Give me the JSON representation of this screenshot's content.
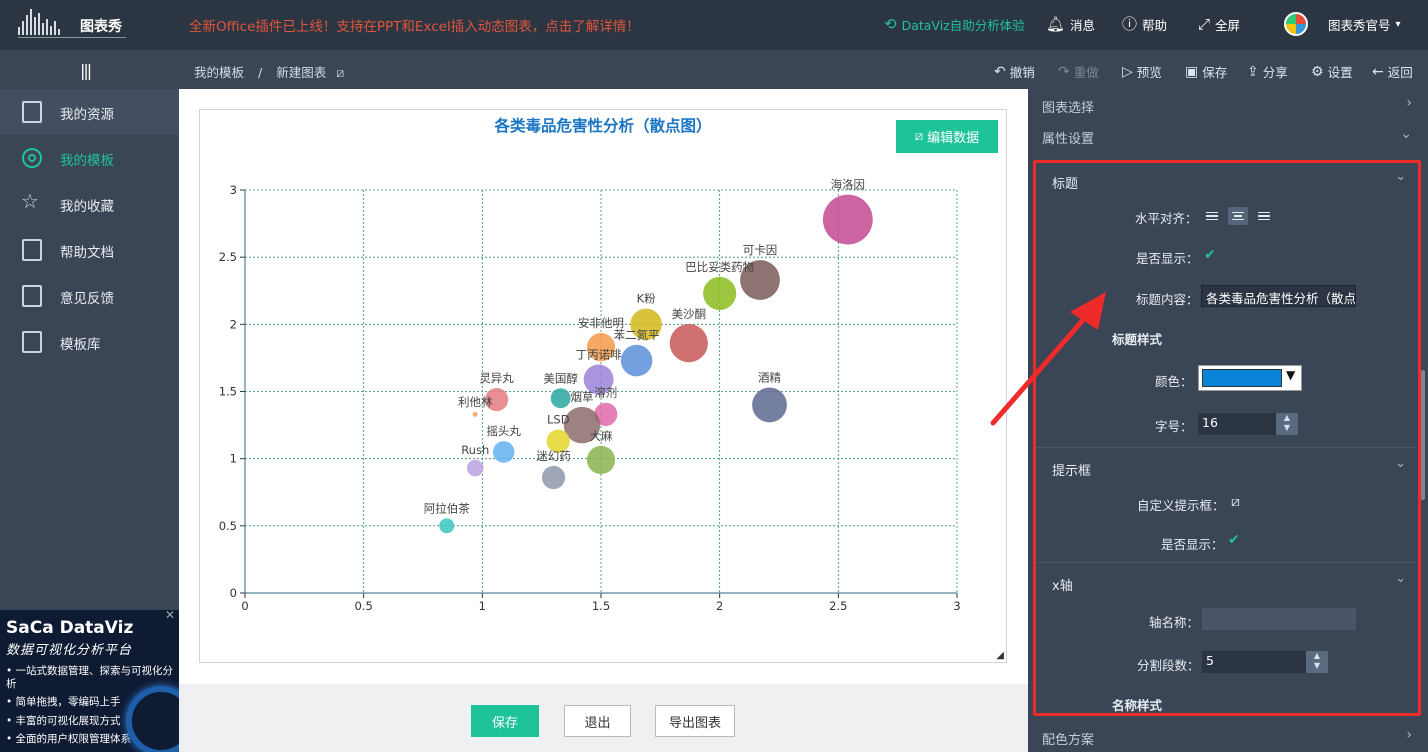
{
  "app": {
    "logo": "图表秀",
    "announcement": "全新Office插件已上线！支持在PPT和Excel插入动态图表，点击了解详情！",
    "dataviz_link": "DataViz自助分析体验",
    "message": "消息",
    "help": "帮助",
    "fullscreen": "全屏",
    "account": "图表秀官号"
  },
  "breadcrumb": {
    "root": "我的模板",
    "sep": "/",
    "current": "新建图表"
  },
  "toolbar": {
    "undo": "撤销",
    "redo": "重做",
    "preview": "预览",
    "save": "保存",
    "share": "分享",
    "settings": "设置",
    "back": "返回"
  },
  "sidebar": {
    "items": [
      {
        "label": "我的资源"
      },
      {
        "label": "我的模板"
      },
      {
        "label": "我的收藏"
      },
      {
        "label": "帮助文档"
      },
      {
        "label": "意见反馈"
      },
      {
        "label": "模板库"
      }
    ]
  },
  "promo": {
    "title": "SaCa DataViz",
    "subtitle": "数据可视化分析平台",
    "bullets": [
      "• 一站式数据管理、探索与可视化分析",
      "• 简单拖拽，零编码上手",
      "• 丰富的可视化展现方式",
      "• 全面的用户权限管理体系"
    ],
    "close": "✕"
  },
  "editor": {
    "edit_data": "编辑数据"
  },
  "bottom": {
    "save": "保存",
    "exit": "退出",
    "export": "导出图表"
  },
  "panel": {
    "chart_select": "图表选择",
    "property_settings": "属性设置",
    "color_scheme": "配色方案",
    "title_section": {
      "heading": "标题",
      "align_label": "水平对齐：",
      "show_label": "是否显示：",
      "content_label": "标题内容：",
      "content_value": "各类毒品危害性分析（散点",
      "style_heading": "标题样式",
      "color_label": "颜色：",
      "color_value": "#0a84d6",
      "size_label": "字号：",
      "size_value": "16"
    },
    "tooltip_section": {
      "heading": "提示框",
      "custom_label": "自定义提示框：",
      "show_label": "是否显示："
    },
    "xaxis_section": {
      "heading": "x轴",
      "name_label": "轴名称：",
      "name_value": "",
      "split_label": "分割段数：",
      "split_value": "5",
      "name_style": "名称样式"
    }
  },
  "chart_data": {
    "type": "scatter",
    "title": "各类毒品危害性分析（散点图）",
    "xlim": [
      0,
      3
    ],
    "ylim": [
      0,
      3
    ],
    "xticks": [
      "0",
      "0.5",
      "1",
      "1.5",
      "2",
      "2.5",
      "3"
    ],
    "yticks": [
      "0",
      "0.5",
      "1",
      "1.5",
      "2",
      "2.5",
      "3"
    ],
    "grid": true,
    "points": [
      {
        "name": "海洛因",
        "x": 2.54,
        "y": 2.78,
        "size": 3.0,
        "color": "#c2498f"
      },
      {
        "name": "可卡因",
        "x": 2.17,
        "y": 2.33,
        "size": 2.4,
        "color": "#7a5a5a"
      },
      {
        "name": "巴比妥类药物",
        "x": 2.0,
        "y": 2.23,
        "size": 2.0,
        "color": "#8bbb1e"
      },
      {
        "name": "K粉",
        "x": 1.69,
        "y": 2.0,
        "size": 1.9,
        "color": "#d4b81a"
      },
      {
        "name": "美沙酮",
        "x": 1.87,
        "y": 1.86,
        "size": 2.3,
        "color": "#c95757"
      },
      {
        "name": "苯二氮平",
        "x": 1.65,
        "y": 1.73,
        "size": 1.9,
        "color": "#5b8fd9"
      },
      {
        "name": "安非他明",
        "x": 1.5,
        "y": 1.83,
        "size": 1.7,
        "color": "#f39a4a"
      },
      {
        "name": "丁丙诺啡",
        "x": 1.49,
        "y": 1.59,
        "size": 1.8,
        "color": "#9b82d9"
      },
      {
        "name": "酒精",
        "x": 2.21,
        "y": 1.4,
        "size": 2.1,
        "color": "#5d6990"
      },
      {
        "name": "美国醇",
        "x": 1.33,
        "y": 1.45,
        "size": 1.2,
        "color": "#2aa6a0"
      },
      {
        "name": "溶剂",
        "x": 1.52,
        "y": 1.33,
        "size": 1.4,
        "color": "#e06aa9"
      },
      {
        "name": "烟草",
        "x": 1.42,
        "y": 1.25,
        "size": 2.2,
        "color": "#8d6b6b"
      },
      {
        "name": "灵异丸",
        "x": 1.06,
        "y": 1.44,
        "size": 1.4,
        "color": "#e37b7f"
      },
      {
        "name": "利他林",
        "x": 0.97,
        "y": 1.33,
        "size": 0.3,
        "color": "#f2a05a"
      },
      {
        "name": "LSD",
        "x": 1.32,
        "y": 1.13,
        "size": 1.4,
        "color": "#e3d52a"
      },
      {
        "name": "大麻",
        "x": 1.5,
        "y": 0.99,
        "size": 1.7,
        "color": "#8ab34f"
      },
      {
        "name": "摇头丸",
        "x": 1.09,
        "y": 1.05,
        "size": 1.3,
        "color": "#62b3f0"
      },
      {
        "name": "迷幻药",
        "x": 1.3,
        "y": 0.86,
        "size": 1.4,
        "color": "#8d96ab"
      },
      {
        "name": "Rush",
        "x": 0.97,
        "y": 0.93,
        "size": 1.0,
        "color": "#b9a2e0"
      },
      {
        "name": "阿拉伯茶",
        "x": 0.85,
        "y": 0.5,
        "size": 0.9,
        "color": "#39c5c0"
      }
    ]
  }
}
